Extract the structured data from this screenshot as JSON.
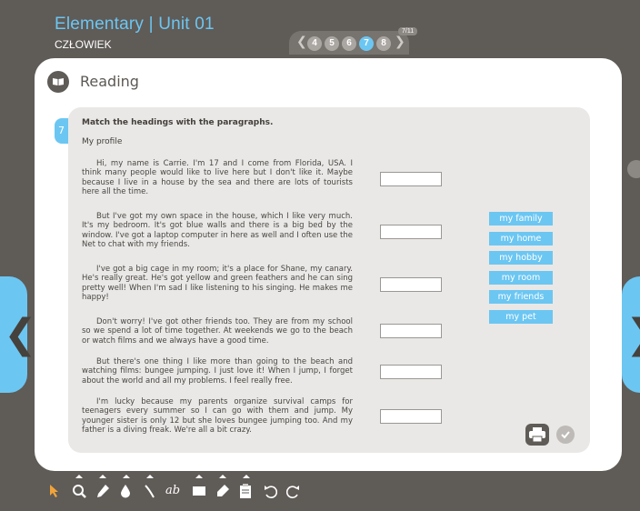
{
  "header": {
    "title": "Elementary | Unit 01",
    "subtitle": "CZŁOWIEK"
  },
  "pager": {
    "count": "7/11",
    "pages": [
      "4",
      "5",
      "6",
      "7",
      "8"
    ],
    "active": "7",
    "prev_glyph": "❮",
    "next_glyph": "❯"
  },
  "nav": {
    "left_glyph": "❮",
    "right_glyph": "❯"
  },
  "section": {
    "title": "Reading"
  },
  "exercise": {
    "number": "7",
    "instruction": "Match the headings with the paragraphs.",
    "text_title": "My profile",
    "paragraphs": [
      "Hi, my name is Carrie. I'm  17 and I come  from Florida, USA. I think many people would like to live here but I don't like it. Maybe because I live in a house by the sea and there are lots of tourists here all the time.",
      "But I've got my own space in the house, which I like very much. It's my bedroom. It's got blue walls and there is a big bed by the window. I've  got a laptop  computer in here as well and I often use the Net to chat with my friends.",
      "I've got a big cage in my room; it's a place for Shane, my canary. He's really great. He's got yellow and green feathers and he can sing pretty well! When I'm sad I like listening to his singing. He makes me happy!",
      "Don't worry! I've got other friends too. They are from my school so we spend a lot of time together. At weekends we go to the beach or watch films and we always have a good time.",
      "But there's one thing I like more than going to the beach and watching films: bungee jumping. I just love it! When I jump, I forget about the world and all my problems. I feel really free.",
      "I'm lucky because my parents organize survival camps for teenagers every summer so I can go with them and jump. My younger sister is only 12 but she loves bungee jumping too. And my father is a diving freak. We're all a bit crazy."
    ],
    "answers": [
      "",
      "",
      "",
      "",
      "",
      ""
    ],
    "headings": [
      "my family",
      "my home",
      "my hobby",
      "my room",
      "my friends",
      "my pet"
    ]
  },
  "icons": {
    "book": "book-icon",
    "print": "printer-icon",
    "check": "checkmark-icon",
    "tools": [
      "pointer-icon",
      "zoom-icon",
      "pen-icon",
      "ink-drop-icon",
      "line-icon",
      "text-icon",
      "rectangle-icon",
      "eraser-icon",
      "clipboard-icon",
      "undo-icon",
      "redo-icon"
    ]
  },
  "colors": {
    "accent": "#6cc6f2",
    "background": "#5f5b57",
    "panel": "#e9e8e6"
  }
}
